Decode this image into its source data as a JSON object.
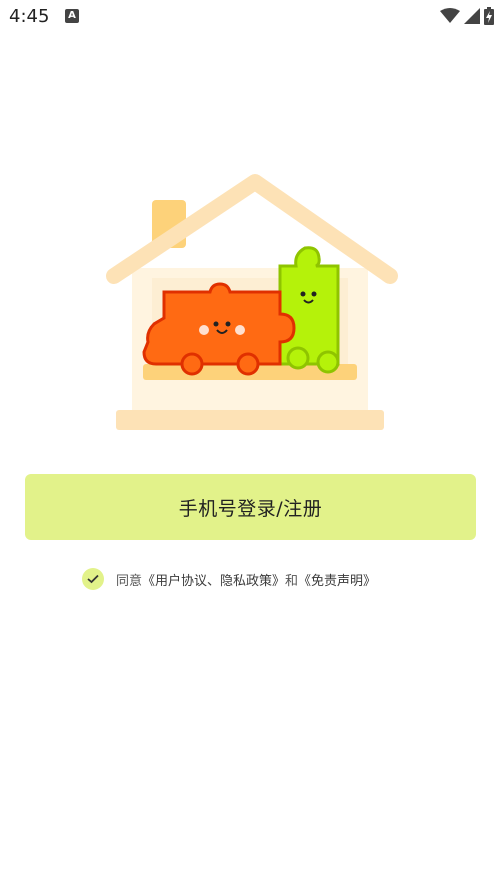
{
  "status_bar": {
    "time": "4:45",
    "notification_icon": "a-icon",
    "wifi_icon": "wifi-icon",
    "signal_icon": "signal-icon",
    "battery_icon": "battery-charging-icon"
  },
  "login": {
    "button_label": "手机号登录/注册"
  },
  "agreement": {
    "checked": true,
    "prefix": "同意",
    "terms_link": "《用户协议、隐私政策》",
    "conjunction": "和",
    "disclaimer_link": "《免责声明》"
  },
  "colors": {
    "accent": "#e2f28a",
    "house": "#fde8c2",
    "house_inner": "#fff4e0",
    "red_puzzle": "#ff6a13",
    "green_puzzle": "#b5f20a"
  }
}
